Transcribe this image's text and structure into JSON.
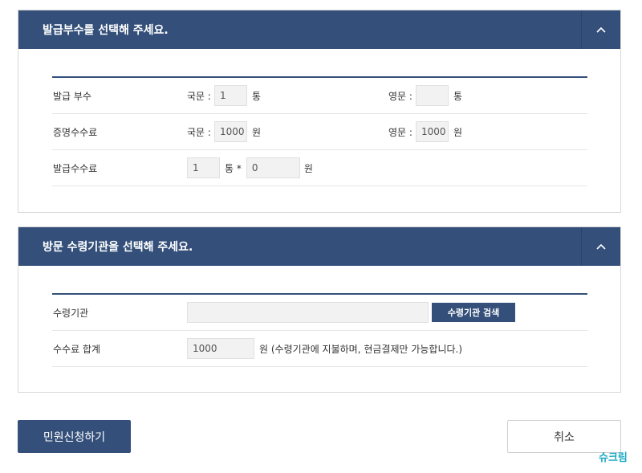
{
  "copies_panel": {
    "title": "발급부수를 선택해 주세요.",
    "rows": {
      "copies": {
        "label": "발급 부수",
        "korean_label": "국문 :",
        "korean_value": "1",
        "korean_unit": "통",
        "english_label": "영문 :",
        "english_value": "",
        "english_unit": "통"
      },
      "cert_fee": {
        "label": "증명수수료",
        "korean_label": "국문 :",
        "korean_value": "1000",
        "korean_unit": "원",
        "english_label": "영문 :",
        "english_value": "1000",
        "english_unit": "원"
      },
      "issue_fee": {
        "label": "발급수수료",
        "count_value": "1",
        "count_unit": "통 *",
        "fee_value": "0",
        "fee_unit": "원"
      }
    }
  },
  "pickup_panel": {
    "title": "방문 수령기관을 선택해 주세요.",
    "rows": {
      "agency": {
        "label": "수령기관",
        "value": "",
        "search_button": "수령기관 검색"
      },
      "total": {
        "label": "수수료 합계",
        "value": "1000",
        "note": "원 (수령기관에 지불하며, 현금결제만 가능합니다.)"
      }
    }
  },
  "buttons": {
    "submit": "민원신청하기",
    "cancel": "취소"
  },
  "watermark": "슈크림",
  "icons": {
    "collapse": "chevron-up-icon"
  },
  "colors": {
    "primary": "#34507a",
    "input_bg": "#f2f2f2",
    "watermark": "#1aa8c4"
  }
}
